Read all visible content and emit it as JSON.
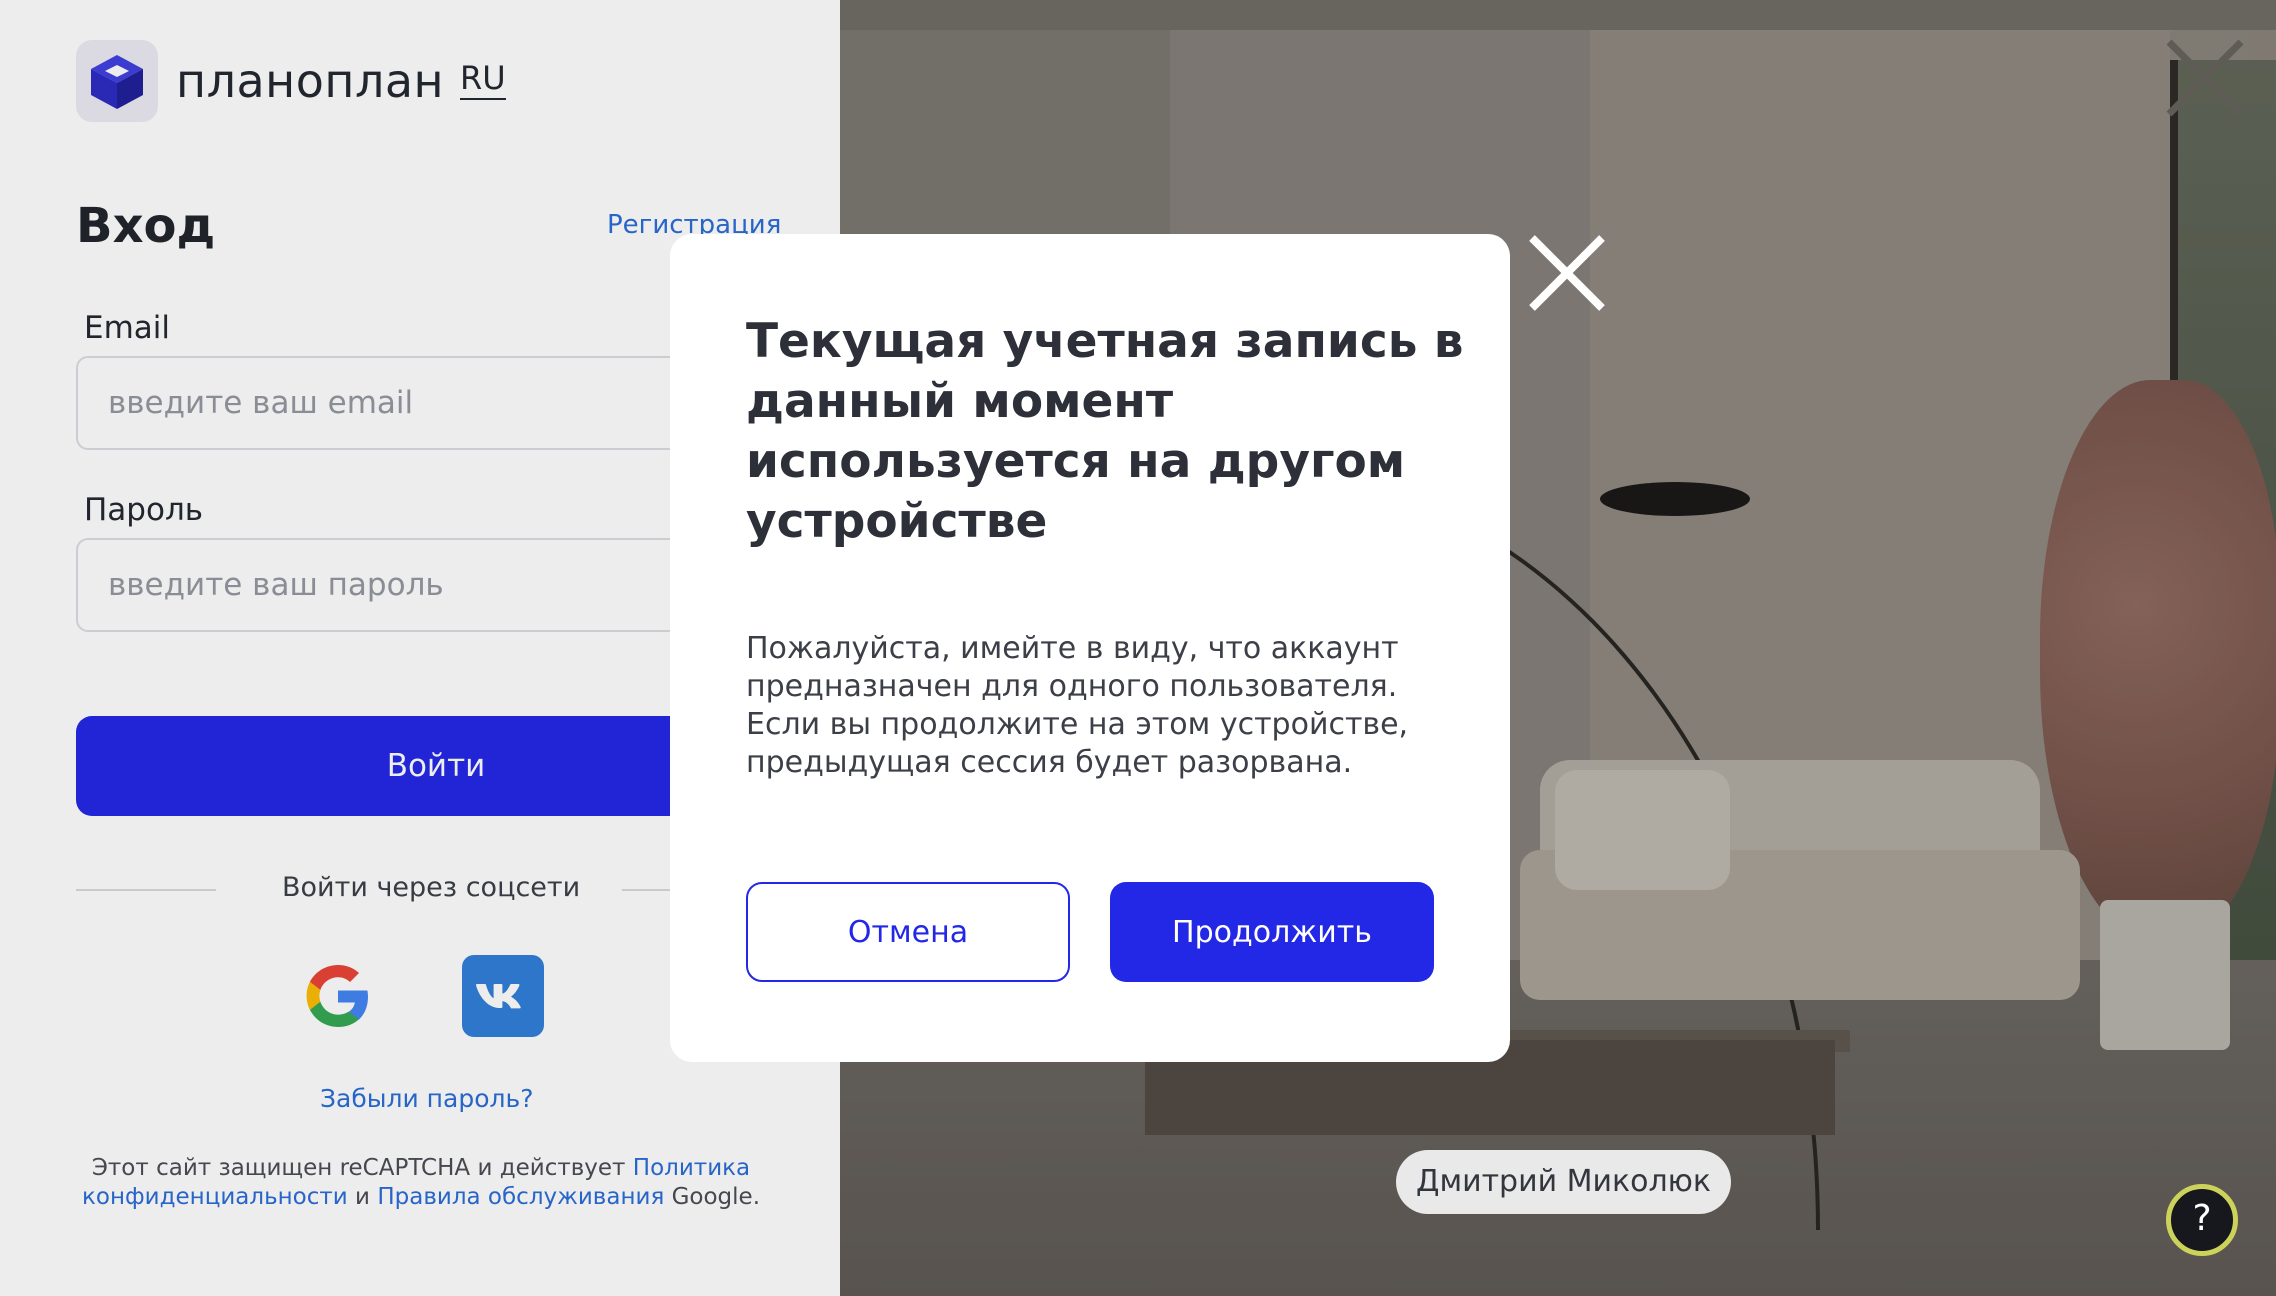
{
  "colors": {
    "primary": "#2327e6",
    "link": "#2a6cd8",
    "vk": "#2f7ed8",
    "help_ring": "#cdd35a"
  },
  "brand": {
    "name": "планоплан",
    "logo_icon": "cube-logo-icon",
    "language": "RU"
  },
  "login": {
    "title": "Вход",
    "register_link": "Регистрация",
    "email_label": "Email",
    "email_placeholder": "введите ваш email",
    "password_label": "Пароль",
    "password_placeholder": "введите ваш пароль",
    "submit_label": "Войти",
    "social_caption": "Войти через соцсети",
    "social_icons": [
      "google-icon",
      "vk-icon"
    ],
    "forgot_link": "Забыли пароль?"
  },
  "recaptcha": {
    "text_before": "Этот сайт защищен reCAPTCHA и действует ",
    "privacy_link": "Политика конфиденциальности",
    "text_middle": " и ",
    "terms_link": "Правила обслуживания",
    "text_after": " Google."
  },
  "photo": {
    "author": "Дмитрий Миколюк",
    "close_icon": "close-icon",
    "help_label": "?"
  },
  "modal": {
    "title": "Текущая учетная запись в данный момент используется на другом устройстве",
    "body": "Пожалуйста, имейте в виду, что аккаунт предназначен для одного пользователя. Если вы продолжите на этом устройстве, предыдущая сессия будет разорвана.",
    "cancel_label": "Отмена",
    "continue_label": "Продолжить",
    "close_icon": "close-icon"
  }
}
